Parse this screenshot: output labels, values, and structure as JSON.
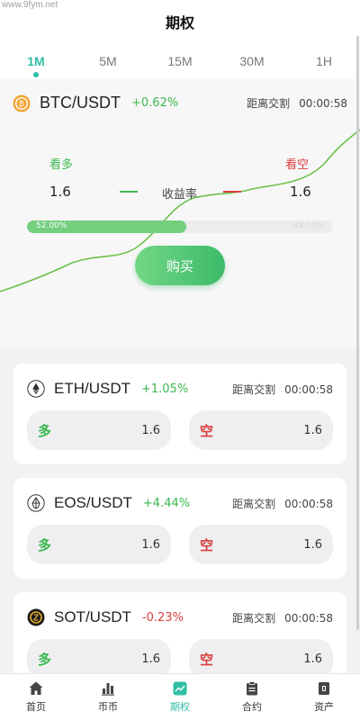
{
  "watermark": "www.9fym.net",
  "header": {
    "title": "期权"
  },
  "tabs": [
    {
      "label": "1M",
      "active": true
    },
    {
      "label": "5M"
    },
    {
      "label": "15M"
    },
    {
      "label": "30M"
    },
    {
      "label": "1H"
    }
  ],
  "hero": {
    "pair": "BTC/USDT",
    "change": "+0.62%",
    "countdown_label": "距离交割",
    "countdown_time": "00:00:58",
    "long_label": "看多",
    "short_label": "看空",
    "long_value": "1.6",
    "short_value": "1.6",
    "yield_label": "收益率",
    "long_pct": "52.00%",
    "short_pct": "48.00%",
    "long_fraction": 0.52,
    "buy_label": "购买"
  },
  "cards": [
    {
      "pair": "ETH/USDT",
      "change": "+1.05%",
      "trend": "up",
      "countdown_label": "距离交割",
      "countdown_time": "00:00:58",
      "long_side": "多",
      "long_value": "1.6",
      "short_side": "空",
      "short_value": "1.6"
    },
    {
      "pair": "EOS/USDT",
      "change": "+4.44%",
      "trend": "up",
      "countdown_label": "距离交割",
      "countdown_time": "00:00:58",
      "long_side": "多",
      "long_value": "1.6",
      "short_side": "空",
      "short_value": "1.6"
    },
    {
      "pair": "SOT/USDT",
      "change": "-0.23%",
      "trend": "down",
      "countdown_label": "距离交割",
      "countdown_time": "00:00:58",
      "long_side": "多",
      "long_value": "1.6",
      "short_side": "空",
      "short_value": "1.6"
    }
  ],
  "tabbar": [
    {
      "label": "首页",
      "icon": "home-icon"
    },
    {
      "label": "币币",
      "icon": "bar-chart-icon"
    },
    {
      "label": "期权",
      "icon": "option-chart-icon",
      "active": true
    },
    {
      "label": "合约",
      "icon": "clipboard-icon"
    },
    {
      "label": "资产",
      "icon": "wallet-icon"
    }
  ],
  "colors": {
    "accent": "#2fbfa6",
    "up": "#3cb84f",
    "down": "#d9403e"
  }
}
